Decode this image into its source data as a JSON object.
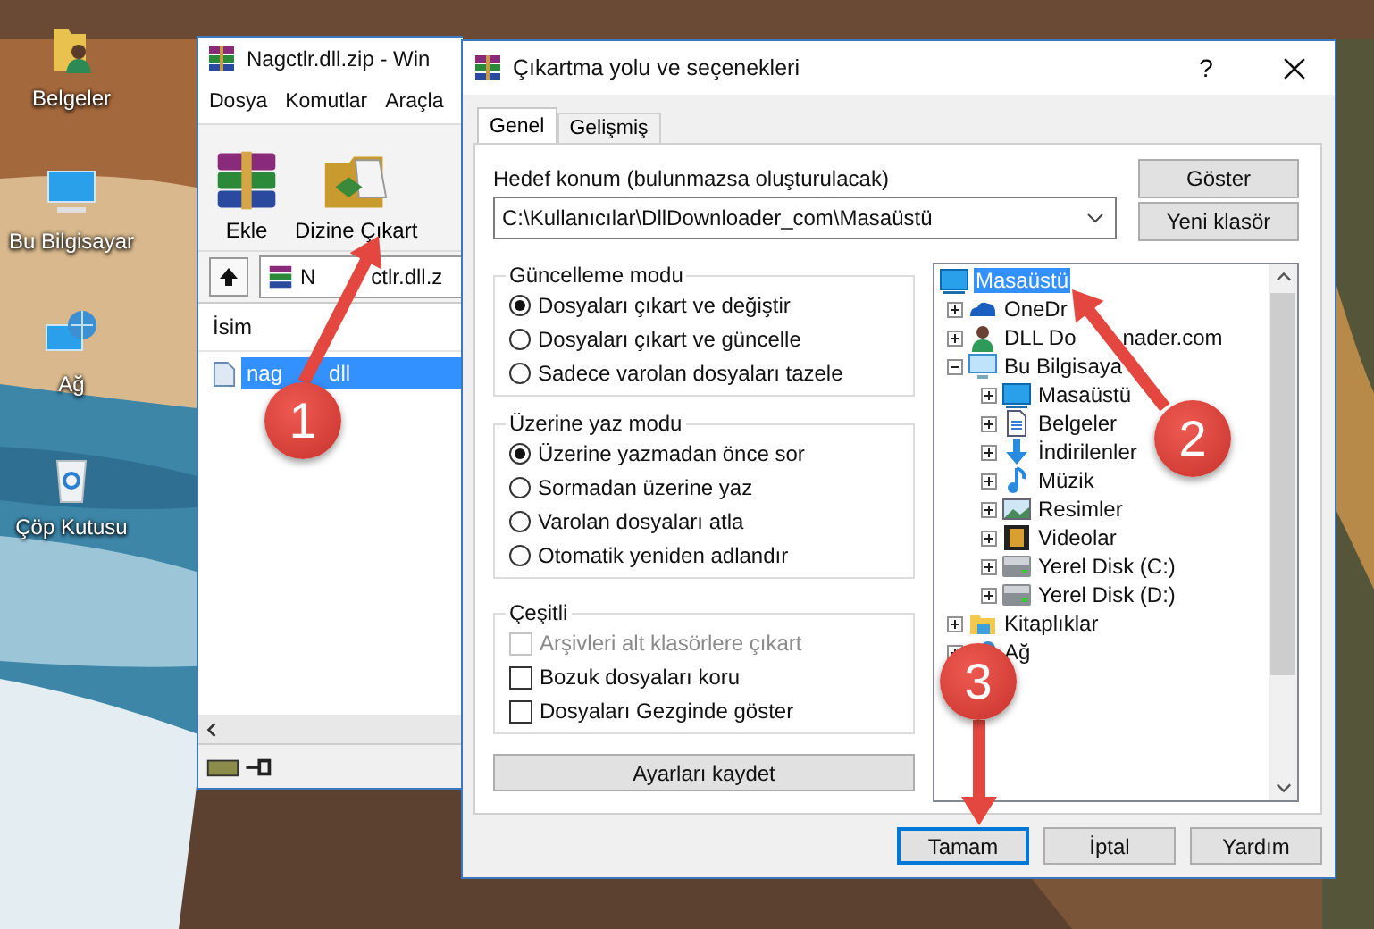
{
  "desktop": {
    "icons": [
      {
        "label": "Belgeler",
        "kind": "user-folder"
      },
      {
        "label": "Bu Bilgisayar",
        "kind": "computer"
      },
      {
        "label": "Ağ",
        "kind": "network"
      },
      {
        "label": "Çöp Kutusu",
        "kind": "recycle-bin"
      }
    ]
  },
  "archive_window": {
    "title": "Nagctlr.dll.zip - Win",
    "menu": [
      "Dosya",
      "Komutlar",
      "Araçla"
    ],
    "toolbar": [
      {
        "label": "Ekle",
        "kind": "add"
      },
      {
        "label": "Dizine Çıkart",
        "kind": "extract"
      }
    ],
    "path": {
      "value": "N",
      "value_tail": "ctlr.dll.z"
    },
    "columns": [
      "İsim"
    ],
    "files": [
      {
        "label": "nag",
        "label_tail": "dll",
        "selected": true
      }
    ]
  },
  "dialog": {
    "title": "Çıkartma yolu ve seçenekleri",
    "help": "?",
    "tabs": [
      {
        "label": "Genel",
        "selected": true
      },
      {
        "label": "Gelişmiş",
        "selected": false
      }
    ],
    "destination": {
      "label": "Hedef konum (bulunmazsa oluşturulacak)",
      "value": "C:\\Kullanıcılar\\DllDownloader_com\\Masaüstü"
    },
    "side_buttons": [
      "Göster",
      "Yeni klasör"
    ],
    "groups": [
      {
        "title": "Güncelleme modu",
        "kind": "radio",
        "options": [
          {
            "label": "Dosyaları çıkart ve değiştir",
            "checked": true
          },
          {
            "label": "Dosyaları çıkart ve güncelle",
            "checked": false
          },
          {
            "label": "Sadece varolan dosyaları tazele",
            "checked": false
          }
        ]
      },
      {
        "title": "Üzerine yaz modu",
        "kind": "radio",
        "options": [
          {
            "label": "Üzerine yazmadan önce sor",
            "checked": true
          },
          {
            "label": "Sormadan üzerine yaz",
            "checked": false
          },
          {
            "label": "Varolan dosyaları atla",
            "checked": false
          },
          {
            "label": "Otomatik yeniden adlandır",
            "checked": false
          }
        ]
      },
      {
        "title": "Çeşitli",
        "kind": "checkbox",
        "options": [
          {
            "label": "Arşivleri alt klasörlere çıkart",
            "checked": false,
            "disabled": true
          },
          {
            "label": "Bozuk dosyaları koru",
            "checked": false,
            "disabled": false
          },
          {
            "label": "Dosyaları Gezginde göster",
            "checked": false,
            "disabled": false
          }
        ]
      }
    ],
    "save_button": "Ayarları kaydet",
    "tree": [
      {
        "label": "Masaüstü",
        "kind": "desktop",
        "selected": true,
        "children": [
          {
            "label": "OneDr",
            "kind": "cloud",
            "expanded": false,
            "selected": false
          },
          {
            "label": "DLL Do",
            "label_tail": "nader.com",
            "kind": "person",
            "expanded": false,
            "selected": false
          },
          {
            "label": "Bu Bilgisaya",
            "kind": "pc",
            "expanded": true,
            "selected": false,
            "children": [
              {
                "label": "Masaüstü",
                "kind": "desktop",
                "expanded": false,
                "selected": false
              },
              {
                "label": "Belgeler",
                "kind": "document",
                "expanded": false,
                "selected": false
              },
              {
                "label": "İndirilenler",
                "kind": "download",
                "expanded": false,
                "selected": false
              },
              {
                "label": "Müzik",
                "kind": "music",
                "expanded": false,
                "selected": false
              },
              {
                "label": "Resimler",
                "kind": "picture",
                "expanded": false,
                "selected": false
              },
              {
                "label": "Videolar",
                "kind": "video",
                "expanded": false,
                "selected": false
              },
              {
                "label": "Yerel Disk (C:)",
                "kind": "drive",
                "expanded": false,
                "selected": false
              },
              {
                "label": "Yerel Disk (D:)",
                "kind": "drive",
                "expanded": false,
                "selected": false
              }
            ]
          },
          {
            "label": "Kitaplıklar",
            "kind": "library",
            "expanded": false,
            "selected": false
          },
          {
            "label": "Ağ",
            "kind": "network",
            "expanded": false,
            "selected": false
          }
        ]
      }
    ],
    "buttons": [
      {
        "label": "Tamam",
        "focused": true
      },
      {
        "label": "İptal",
        "focused": false
      },
      {
        "label": "Yardım",
        "focused": false
      }
    ]
  },
  "annotations": [
    {
      "number": "1"
    },
    {
      "number": "2"
    },
    {
      "number": "3"
    }
  ]
}
